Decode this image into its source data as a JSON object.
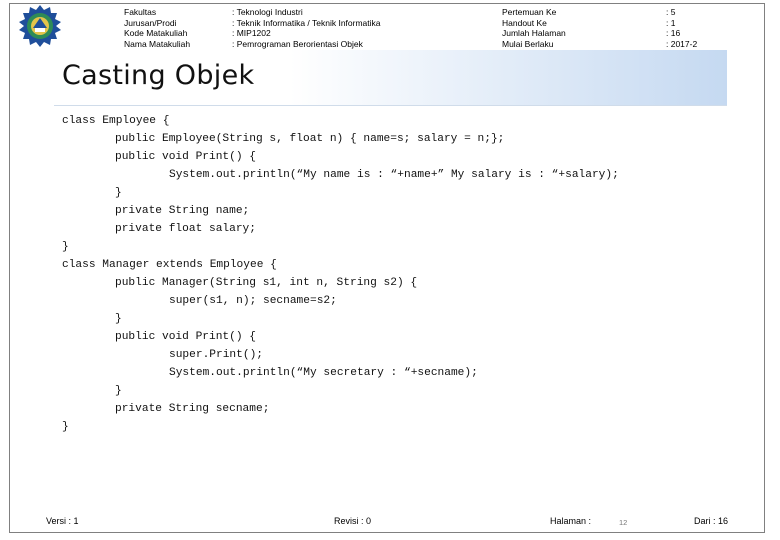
{
  "header": {
    "left_labels": [
      "Fakultas",
      "Jurusan/Prodi",
      "Kode Matakuliah",
      "Nama Matakuliah"
    ],
    "left_values": [
      ": Teknologi Industri",
      ": Teknik Informatika / Teknik Informatika",
      ": MIP1202",
      ": Pemrograman Berorientasi Objek"
    ],
    "right_labels": [
      "Pertemuan Ke",
      "Handout Ke",
      "Jumlah Halaman",
      "Mulai Berlaku"
    ],
    "right_values": [
      ": 5",
      ": 1",
      ": 16",
      ": 2017-2"
    ]
  },
  "logo": {
    "icon": "university-emblem-icon",
    "colors": {
      "primary": "#1f4e9a",
      "accent": "#e3c44a",
      "inner": "#2e8b57"
    }
  },
  "slide": {
    "title": "Casting Objek",
    "band_color": "#c5d9f1",
    "code_lines": [
      {
        "indent": 0,
        "text": "class Employee {"
      },
      {
        "indent": 1,
        "text": "public Employee(String s, float n) { name=s; salary = n;};"
      },
      {
        "indent": 1,
        "text": "public void Print() {"
      },
      {
        "indent": 2,
        "text": "System.out.println(“My name is : “+name+” My salary is : “+salary);"
      },
      {
        "indent": 1,
        "text": "}"
      },
      {
        "indent": 1,
        "text": "private String name;"
      },
      {
        "indent": 1,
        "text": "private float salary;"
      },
      {
        "indent": 0,
        "text": "}"
      },
      {
        "indent": 0,
        "text": "class Manager extends Employee {"
      },
      {
        "indent": 1,
        "text": "public Manager(String s1, int n, String s2) {"
      },
      {
        "indent": 2,
        "text": "super(s1, n); secname=s2;"
      },
      {
        "indent": 1,
        "text": "}"
      },
      {
        "indent": 1,
        "text": "public void Print() {"
      },
      {
        "indent": 2,
        "text": "super.Print();"
      },
      {
        "indent": 2,
        "text": "System.out.println(“My secretary : “+secname);"
      },
      {
        "indent": 1,
        "text": "}"
      },
      {
        "indent": 1,
        "text": "private String secname;"
      },
      {
        "indent": 0,
        "text": "}"
      }
    ]
  },
  "footer": {
    "versi": "Versi : 1",
    "revisi": "Revisi : 0",
    "halaman": "Halaman :",
    "page_number": "12",
    "dari": "Dari : 16"
  }
}
